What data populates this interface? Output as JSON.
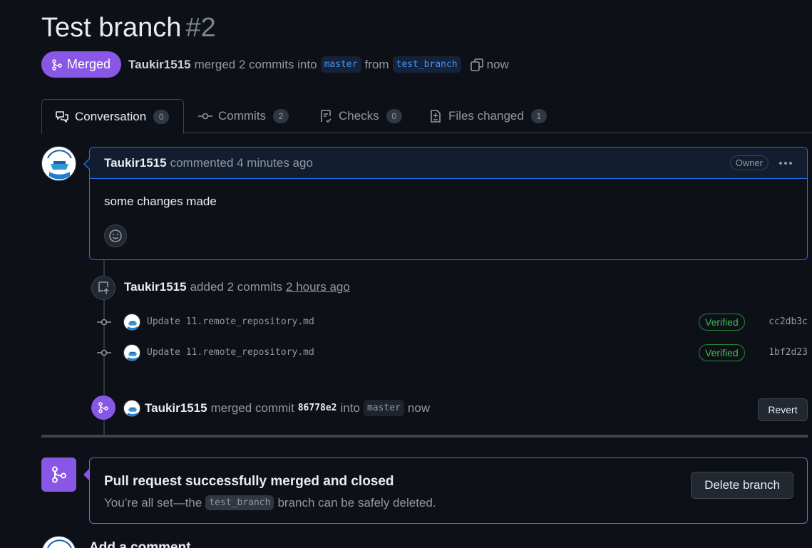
{
  "header": {
    "title": "Test branch",
    "number": "#2"
  },
  "meta": {
    "state": "Merged",
    "author": "Taukir1515",
    "action": "merged 2 commits into",
    "base_branch": "master",
    "from_text": "from",
    "head_branch": "test_branch",
    "time": "now"
  },
  "tabs": [
    {
      "label": "Conversation",
      "count": "0"
    },
    {
      "label": "Commits",
      "count": "2"
    },
    {
      "label": "Checks",
      "count": "0"
    },
    {
      "label": "Files changed",
      "count": "1"
    }
  ],
  "comment": {
    "author": "Taukir1515",
    "action": "commented 4 minutes ago",
    "role": "Owner",
    "body": "some changes made"
  },
  "commits_event": {
    "author": "Taukir1515",
    "action": "added 2 commits",
    "time": "2 hours ago",
    "commits": [
      {
        "message": "Update 11.remote_repository.md",
        "status": "Verified",
        "sha": "cc2db3c"
      },
      {
        "message": "Update 11.remote_repository.md",
        "status": "Verified",
        "sha": "1bf2d23"
      }
    ]
  },
  "merge_event": {
    "author": "Taukir1515",
    "action": "merged commit",
    "commit": "86778e2",
    "into_text": "into",
    "branch": "master",
    "time": "now",
    "revert_label": "Revert"
  },
  "merge_status": {
    "title": "Pull request successfully merged and closed",
    "sub_prefix": "You’re all set—the",
    "branch": "test_branch",
    "sub_suffix": "branch can be safely deleted.",
    "delete_label": "Delete branch"
  },
  "add_comment": {
    "title": "Add a comment"
  },
  "colors": {
    "background": "#0d1117",
    "merged_purple": "#8957e5",
    "accent_blue": "#1f6feb",
    "verified_green": "#3fb950"
  }
}
